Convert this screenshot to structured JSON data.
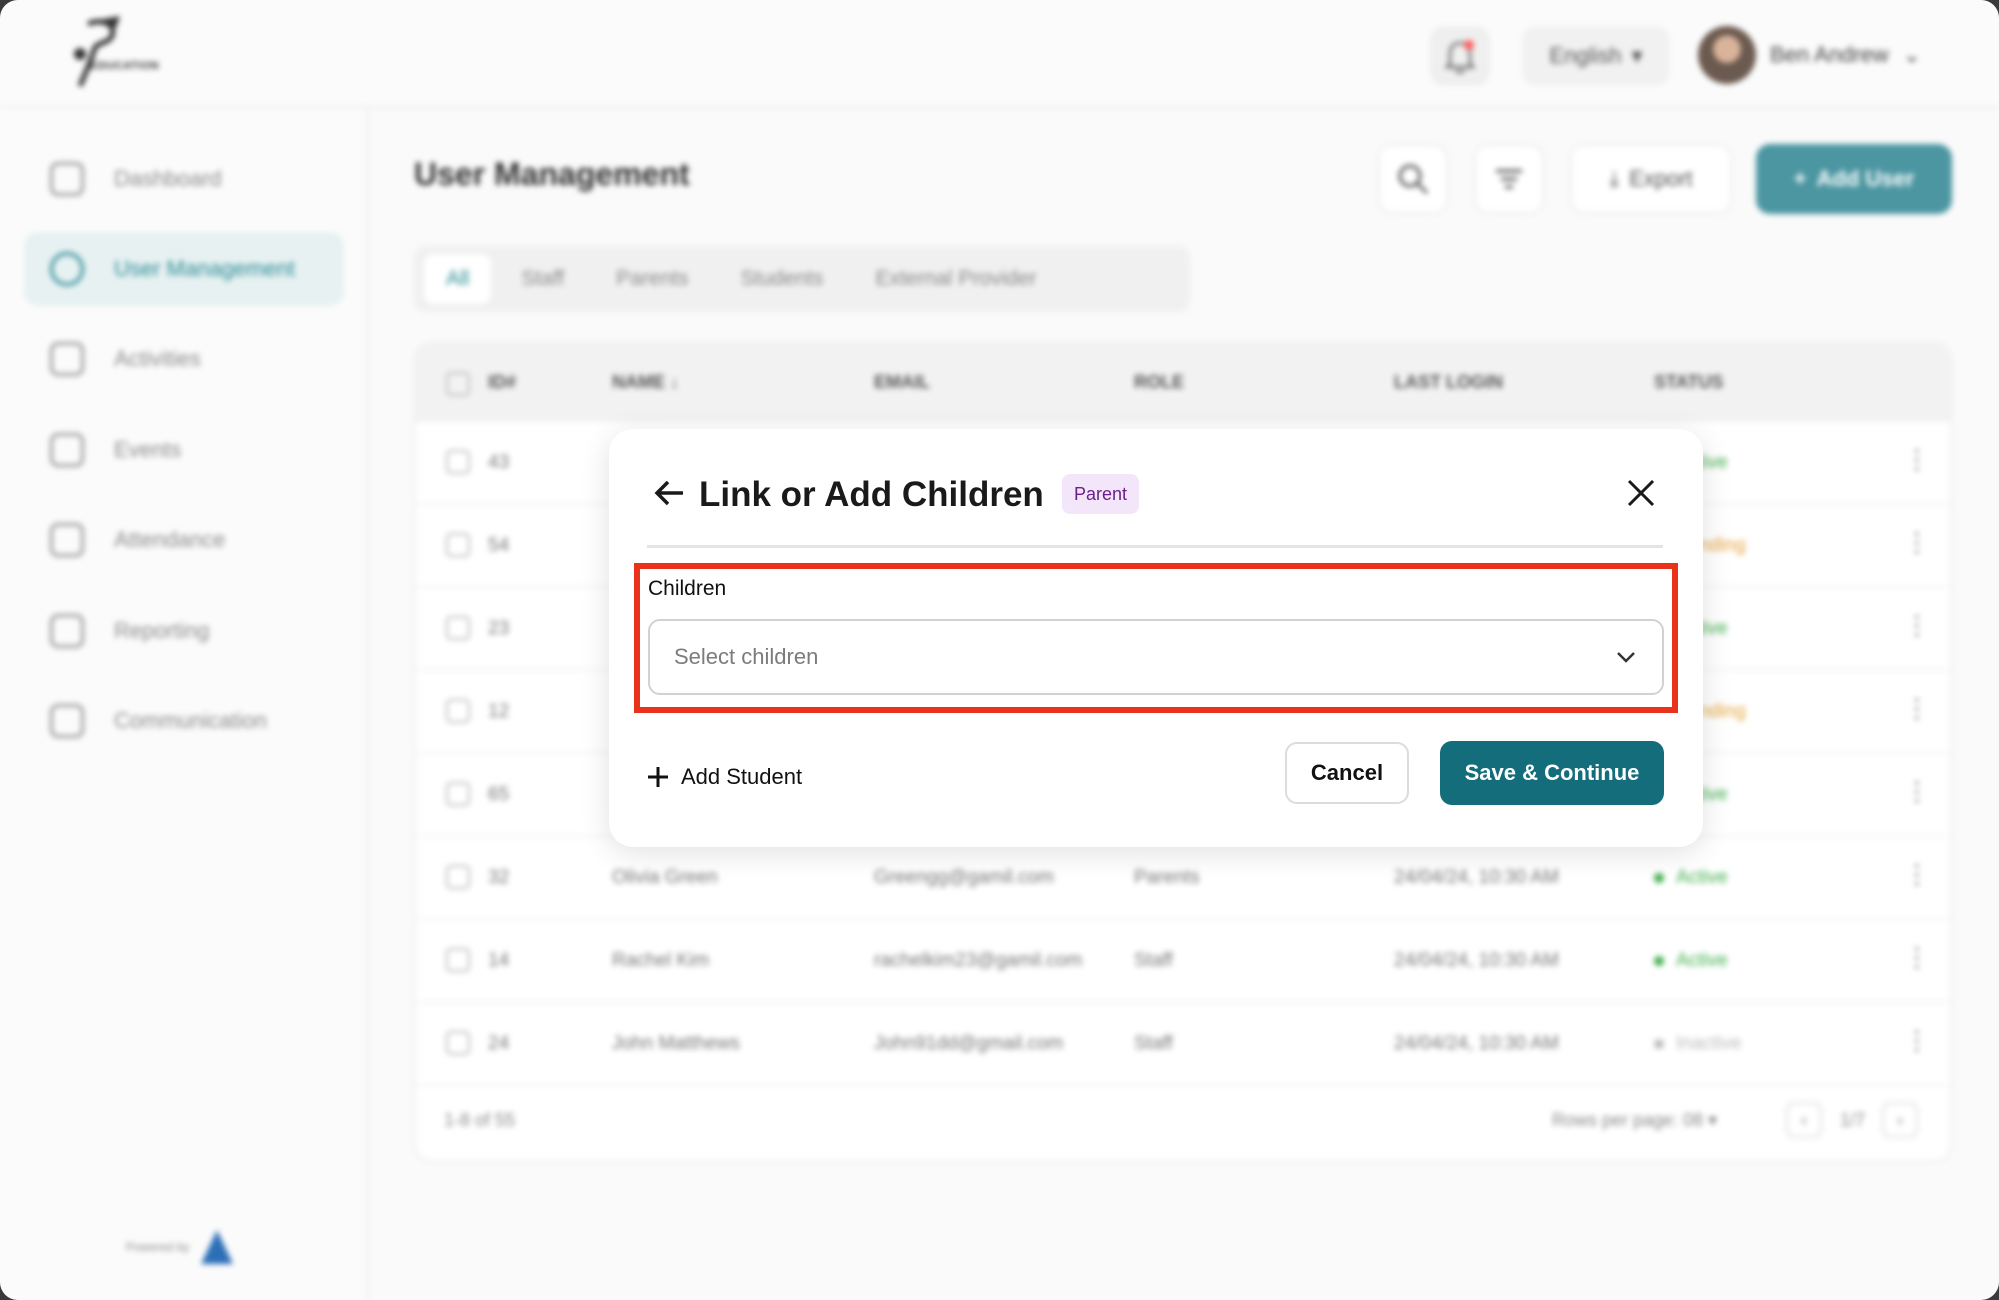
{
  "topbar": {
    "logo_text": "EDUCATION",
    "language": "English",
    "user_name": "Ben Andrew"
  },
  "sidebar": {
    "items": [
      {
        "label": "Dashboard",
        "icon": "grid-icon"
      },
      {
        "label": "User Management",
        "icon": "users-icon"
      },
      {
        "label": "Activities",
        "icon": "palette-icon"
      },
      {
        "label": "Events",
        "icon": "calendar-icon"
      },
      {
        "label": "Attendance",
        "icon": "calendar-check-icon"
      },
      {
        "label": "Reporting",
        "icon": "bar-chart-icon"
      },
      {
        "label": "Communication",
        "icon": "chat-icon"
      }
    ],
    "powered_by": "Powered by"
  },
  "main": {
    "title": "User Management",
    "export_label": "Export",
    "add_user_label": "Add User",
    "tabs": [
      "All",
      "Staff",
      "Parents",
      "Students",
      "External Provider"
    ],
    "columns": [
      "ID#",
      "NAME",
      "EMAIL",
      "ROLE",
      "LAST LOGIN",
      "STATUS"
    ],
    "rows": [
      {
        "id": "43",
        "name": "",
        "email": "",
        "role": "",
        "last_login": "",
        "status": "Active"
      },
      {
        "id": "54",
        "name": "",
        "email": "",
        "role": "",
        "last_login": "",
        "status": "Pending"
      },
      {
        "id": "23",
        "name": "",
        "email": "",
        "role": "",
        "last_login": "",
        "status": "Active"
      },
      {
        "id": "12",
        "name": "",
        "email": "",
        "role": "",
        "last_login": "",
        "status": "Pending"
      },
      {
        "id": "65",
        "name": "",
        "email": "",
        "role": "",
        "last_login": "",
        "status": "Active"
      },
      {
        "id": "32",
        "name": "Olivia Green",
        "email": "Greengg@gamil.com",
        "role": "Parents",
        "last_login": "24/04/24, 10:30 AM",
        "status": "Active"
      },
      {
        "id": "14",
        "name": "Rachel Kim",
        "email": "rachelkim23@gamil.com",
        "role": "Staff",
        "last_login": "24/04/24, 10:30 AM",
        "status": "Active"
      },
      {
        "id": "24",
        "name": "John Matthews",
        "email": "John91dd@gmail.com",
        "role": "Staff",
        "last_login": "24/04/24, 10:30 AM",
        "status": "Inactive"
      }
    ],
    "footer": {
      "range": "1-8 of 55",
      "rows_per_page": "Rows per page: 08",
      "page": "1/7"
    }
  },
  "modal": {
    "title": "Link or Add Children",
    "badge": "Parent",
    "field_label": "Children",
    "field_placeholder": "Select children",
    "add_student_label": "Add Student",
    "cancel_label": "Cancel",
    "save_label": "Save & Continue"
  },
  "colors": {
    "accent": "#146d7a",
    "highlight": "#e8321c",
    "badge_bg": "#f4e6fa",
    "badge_text": "#6a1f8a",
    "active": "#3fae4a",
    "pending": "#e3a23a",
    "inactive": "#bbbbbb"
  }
}
